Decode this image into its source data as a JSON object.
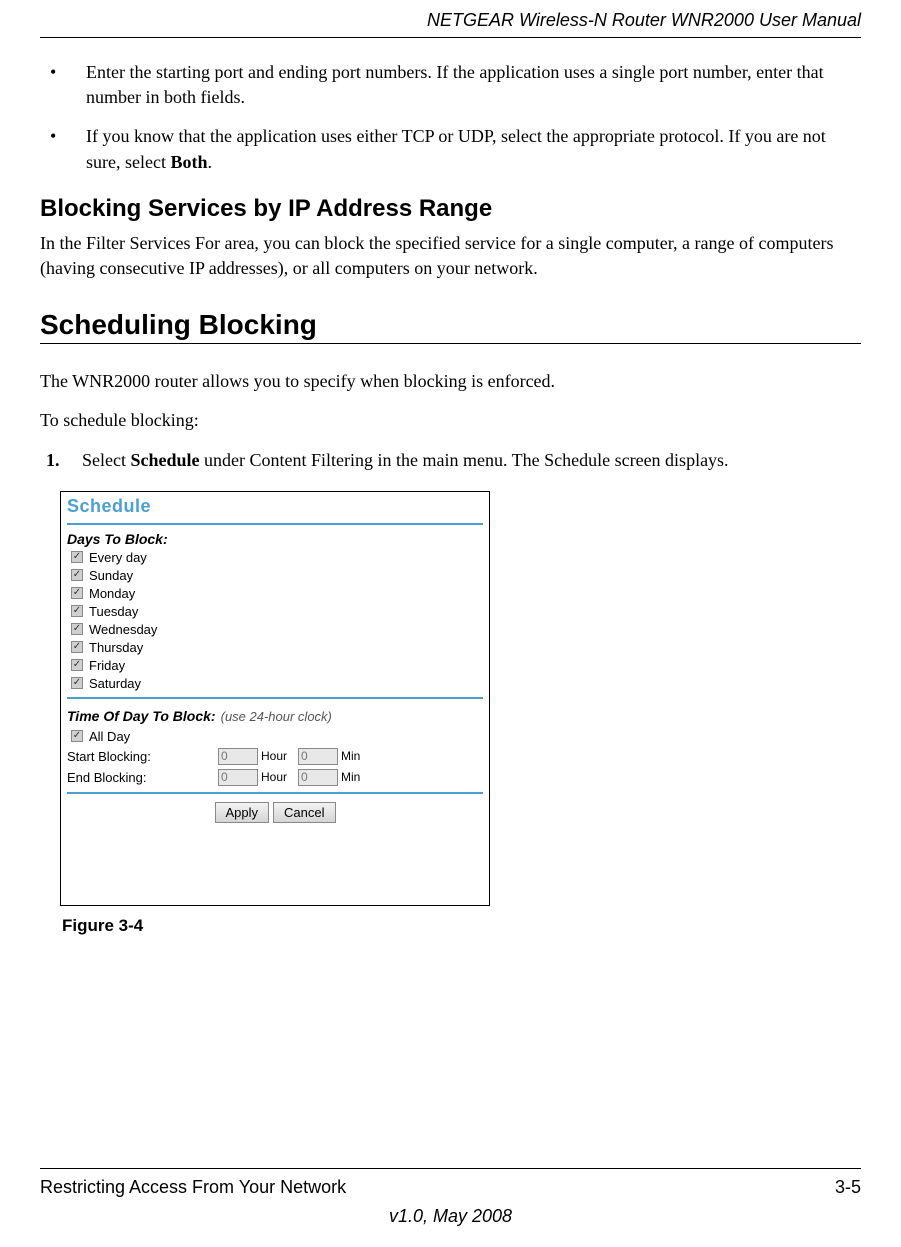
{
  "header": {
    "doc_title": "NETGEAR Wireless-N Router WNR2000 User Manual"
  },
  "content": {
    "bullets": [
      "Enter the starting port and ending port numbers. If the application uses a single port number, enter that number in both fields.",
      "If you know that the application uses either TCP or UDP, select the appropriate protocol. If you are not sure, select "
    ],
    "bullet2_bold": "Both",
    "bullet2_tail": ".",
    "h2": "Blocking Services by IP Address Range",
    "h2_para": "In the Filter Services For area, you can block the specified service for a single computer, a range of computers (having consecutive IP addresses), or all computers on your network.",
    "h1": "Scheduling Blocking",
    "h1_para1": "The WNR2000 router allows you to specify when blocking is enforced.",
    "h1_para2": "To schedule blocking:",
    "step1_pre": "Select ",
    "step1_bold": "Schedule",
    "step1_post": " under Content Filtering in the main menu. The Schedule screen displays.",
    "figure_caption": "Figure 3-4"
  },
  "screenshot": {
    "title": "Schedule",
    "days_label": "Days To Block:",
    "days": [
      {
        "label": "Every day",
        "checked": true,
        "enabled": true
      },
      {
        "label": "Sunday",
        "checked": true,
        "enabled": false
      },
      {
        "label": "Monday",
        "checked": true,
        "enabled": false
      },
      {
        "label": "Tuesday",
        "checked": true,
        "enabled": false
      },
      {
        "label": "Wednesday",
        "checked": true,
        "enabled": false
      },
      {
        "label": "Thursday",
        "checked": true,
        "enabled": false
      },
      {
        "label": "Friday",
        "checked": true,
        "enabled": false
      },
      {
        "label": "Saturday",
        "checked": true,
        "enabled": false
      }
    ],
    "time_label": "Time Of Day To Block:",
    "time_note": "(use 24-hour clock)",
    "all_day": {
      "label": "All Day",
      "checked": true
    },
    "start_label": "Start Blocking:",
    "end_label": "End Blocking:",
    "hour_unit": "Hour",
    "min_unit": "Min",
    "start_hour": "0",
    "start_min": "0",
    "end_hour": "0",
    "end_min": "0",
    "apply": "Apply",
    "cancel": "Cancel"
  },
  "footer": {
    "section": "Restricting Access From Your Network",
    "page": "3-5",
    "version": "v1.0, May 2008"
  }
}
